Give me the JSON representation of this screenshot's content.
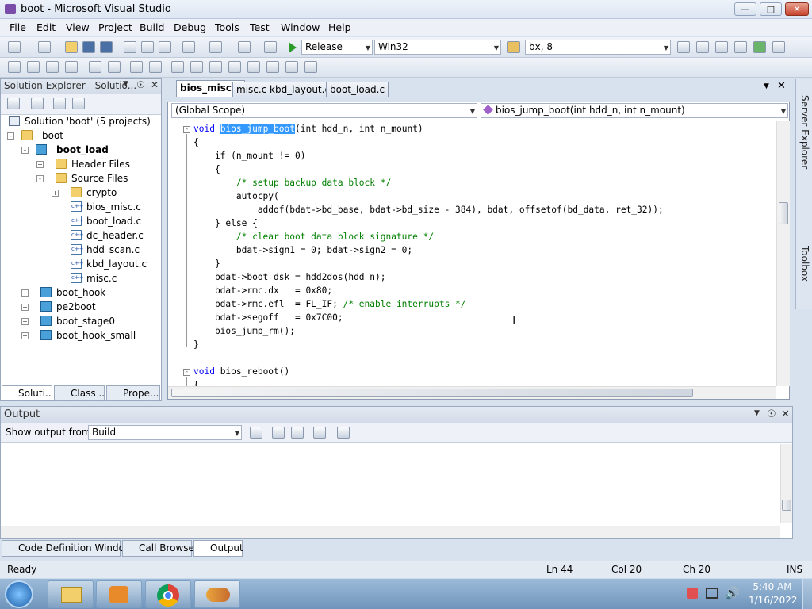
{
  "window": {
    "title": "boot - Microsoft Visual Studio",
    "min": "0",
    "max": "1",
    "close": "r"
  },
  "menu": [
    "File",
    "Edit",
    "View",
    "Project",
    "Build",
    "Debug",
    "Tools",
    "Test",
    "Window",
    "Help"
  ],
  "toolbar": {
    "config": "Release",
    "platform": "Win32",
    "find": "bx, 8"
  },
  "solution_explorer": {
    "title": "Solution Explorer - Solutio...",
    "items": [
      {
        "label": "Solution 'boot' (5 projects)"
      },
      {
        "label": "boot"
      },
      {
        "label": "boot_load"
      },
      {
        "label": "Header Files"
      },
      {
        "label": "Source Files"
      },
      {
        "label": "crypto"
      },
      {
        "label": "bios_misc.c"
      },
      {
        "label": "boot_load.c"
      },
      {
        "label": "dc_header.c"
      },
      {
        "label": "hdd_scan.c"
      },
      {
        "label": "kbd_layout.c"
      },
      {
        "label": "misc.c"
      },
      {
        "label": "boot_hook"
      },
      {
        "label": "pe2boot"
      },
      {
        "label": "boot_stage0"
      },
      {
        "label": "boot_hook_small"
      }
    ],
    "tabs": [
      "Soluti...",
      "Class ...",
      "Prope..."
    ]
  },
  "doc_tabs": [
    "bios_misc.c",
    "misc.c",
    "kbd_layout.c",
    "boot_load.c"
  ],
  "scope": {
    "left": "(Global Scope)",
    "right": "bios_jump_boot(int hdd_n, int n_mount)"
  },
  "code": {
    "l1_kw": "void",
    "l1_sel": "bios_jump_boot",
    "l1_rest": "(int hdd_n, int n_mount)",
    "l2": "{",
    "l3": "    if (n_mount != 0)",
    "l4": "    {",
    "l5": "        /* setup backup data block */",
    "l6": "        autocpy(",
    "l7": "            addof(bdat->bd_base, bdat->bd_size - 384), bdat, offsetof(bd_data, ret_32));",
    "l8": "    } else {",
    "l9": "        /* clear boot data block signature */",
    "l10": "        bdat->sign1 = 0; bdat->sign2 = 0;",
    "l11": "    }",
    "l12": "    bdat->boot_dsk = hdd2dos(hdd_n);",
    "l13": "    bdat->rmc.dx   = 0x80;",
    "l14a": "    bdat->rmc.efl  = FL_IF; ",
    "l14b": "/* enable interrupts */",
    "l15": "    bdat->segoff   = 0x7C00;",
    "l16": "    bios_jump_rm();",
    "l17": "}",
    "l19_kw": "void",
    "l19_rest": " bios_reboot()",
    "l20": "{"
  },
  "output": {
    "title": "Output",
    "show_from_label": "Show output from:",
    "source": "Build"
  },
  "bottom_tabs": [
    "Code Definition Window",
    "Call Browser",
    "Output"
  ],
  "side_tabs": [
    "Server Explorer",
    "Toolbox"
  ],
  "status": {
    "ready": "Ready",
    "ln": "Ln 44",
    "col": "Col 20",
    "ch": "Ch 20",
    "ins": "INS"
  },
  "clock": {
    "time": "5:40 AM",
    "date": "1/16/2022"
  }
}
